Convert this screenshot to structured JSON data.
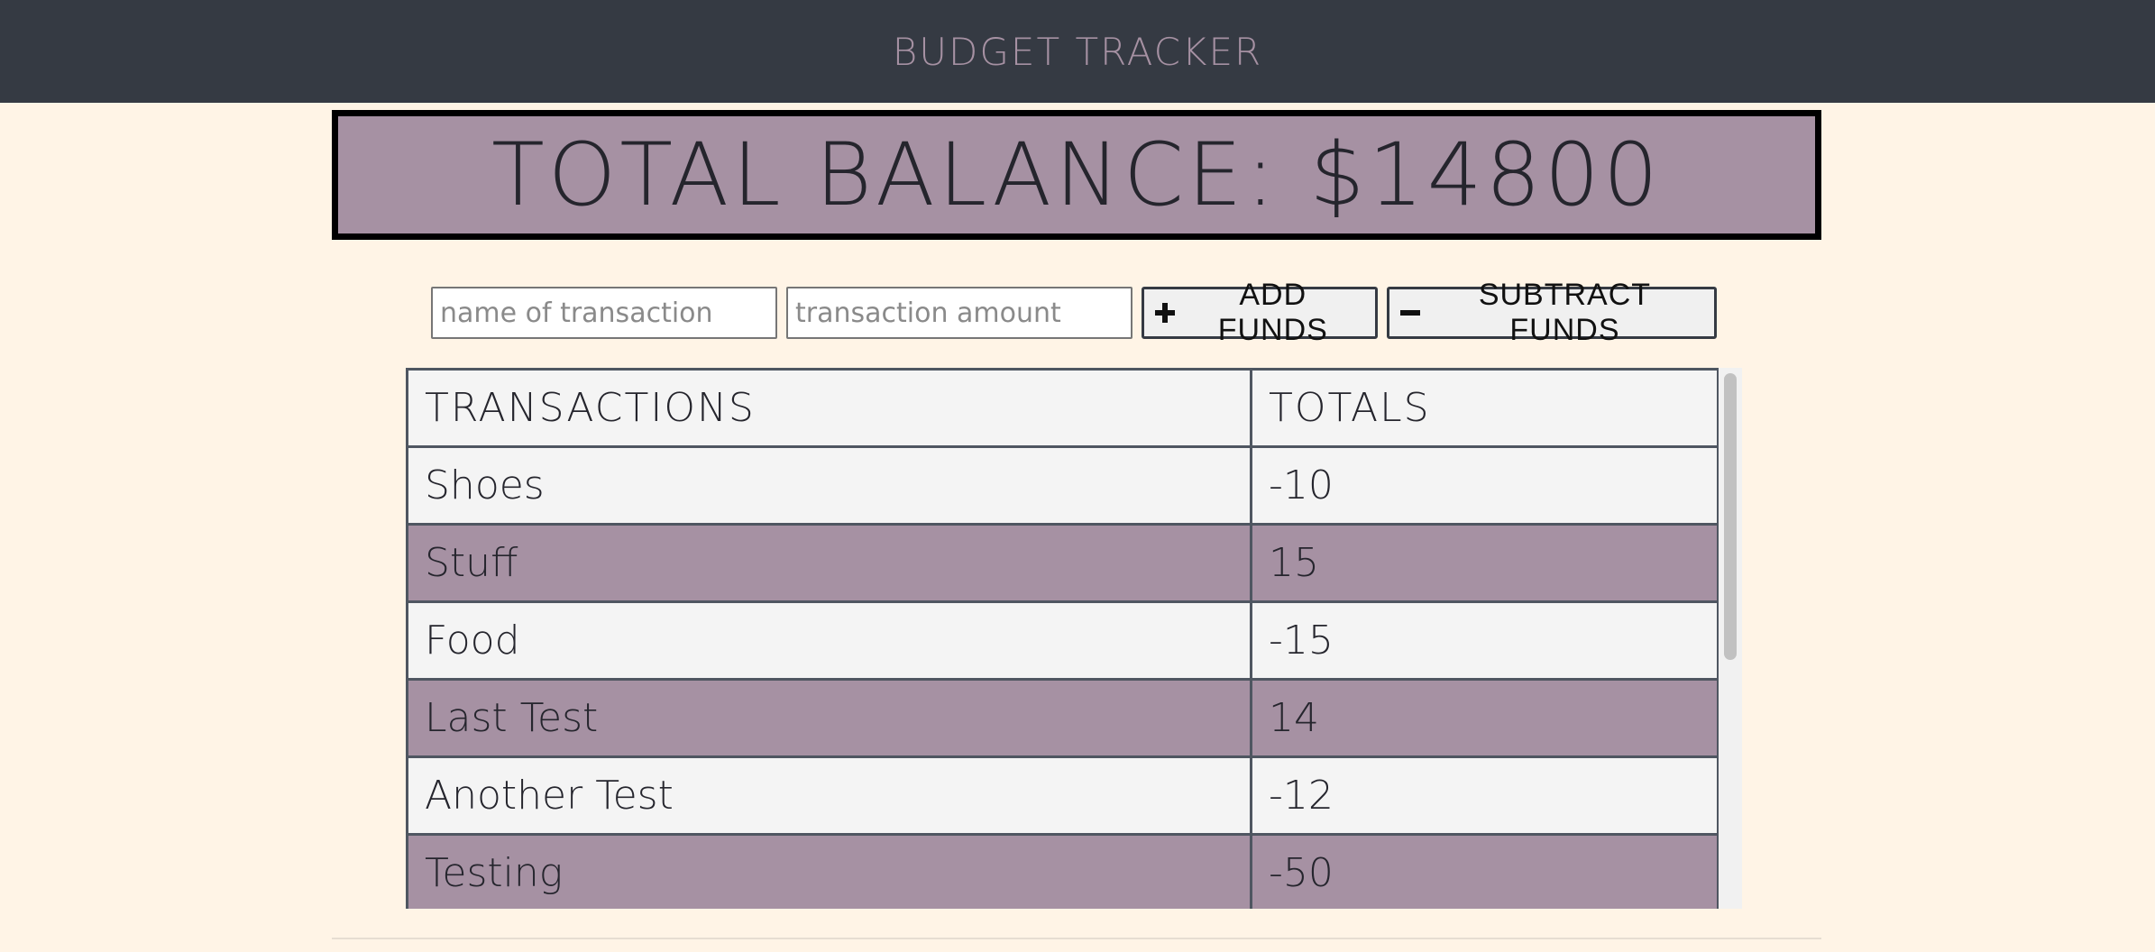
{
  "header": {
    "title": "BUDGET TRACKER"
  },
  "balance": {
    "text": "TOTAL BALANCE: $14800"
  },
  "form": {
    "name_placeholder": "name of transaction",
    "amount_placeholder": "transaction amount",
    "add_label": "ADD FUNDS",
    "subtract_label": "SUBTRACT FUNDS"
  },
  "table": {
    "headers": [
      "TRANSACTIONS",
      "TOTALS"
    ],
    "rows": [
      {
        "name": "Shoes",
        "total": "-10"
      },
      {
        "name": "Stuff",
        "total": "15"
      },
      {
        "name": "Food",
        "total": "-15"
      },
      {
        "name": "Last Test",
        "total": "14"
      },
      {
        "name": "Another Test",
        "total": "-12"
      },
      {
        "name": "Testing",
        "total": "-50"
      }
    ]
  },
  "colors": {
    "page_bg": "#fff4e6",
    "header_bg": "#353a43",
    "accent": "#a691a3"
  }
}
